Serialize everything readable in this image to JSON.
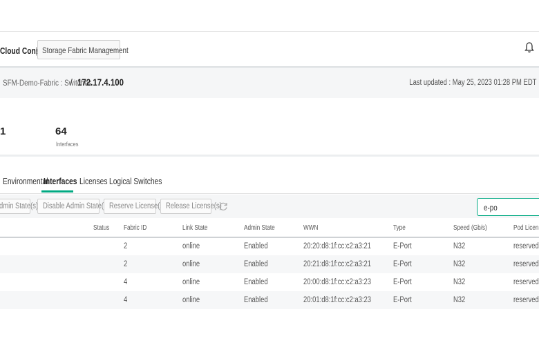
{
  "header": {
    "brand": "Cloud Console",
    "separator": "|",
    "app_selector": "Storage Fabric Management",
    "app_chevron": "⌄",
    "bell_icon": "bell-icon"
  },
  "breadcrumb": {
    "parent": "SFM-Demo-Fabric : Switches",
    "divider": "/",
    "current": "172.17.4.100",
    "last_updated": "Last updated : May 25, 2023 01:28 PM EDT"
  },
  "stats": {
    "partial_value": "1",
    "interfaces_count": "64",
    "interfaces_label": "Interfaces"
  },
  "tabs": [
    "Environmental",
    "Interfaces",
    "Licenses",
    "Logical Switches"
  ],
  "active_tab": "Interfaces",
  "toolbar": {
    "enable_admin": "dmin State(s)",
    "disable_admin": "Disable Admin State(s)",
    "reserve_license": "Reserve License(s)",
    "release_license": "Release License(s)",
    "refresh_icon": "refresh-icon",
    "search_value": "e-po"
  },
  "table": {
    "columns": [
      "Status",
      "Fabric ID",
      "Link State",
      "Admin State",
      "WWN",
      "Type",
      "Speed (Gb/s)",
      "Pod License S"
    ],
    "rows": [
      {
        "fabric_id": "2",
        "link_state": "online",
        "admin_state": "Enabled",
        "wwn": "20:20:d8:1f:cc:c2:a3:21",
        "type": "E-Port",
        "speed": "N32",
        "pod_license": "reserved"
      },
      {
        "fabric_id": "2",
        "link_state": "online",
        "admin_state": "Enabled",
        "wwn": "20:21:d8:1f:cc:c2:a3:21",
        "type": "E-Port",
        "speed": "N32",
        "pod_license": "reserved"
      },
      {
        "fabric_id": "4",
        "link_state": "online",
        "admin_state": "Enabled",
        "wwn": "20:00:d8:1f:cc:c2:a3:23",
        "type": "E-Port",
        "speed": "N32",
        "pod_license": "reserved"
      },
      {
        "fabric_id": "4",
        "link_state": "online",
        "admin_state": "Enabled",
        "wwn": "20:01:d8:1f:cc:c2:a3:23",
        "type": "E-Port",
        "speed": "N32",
        "pod_license": "reserved"
      }
    ]
  },
  "colors": {
    "accent": "#01a982",
    "header_bg": "#f5f6f7"
  }
}
